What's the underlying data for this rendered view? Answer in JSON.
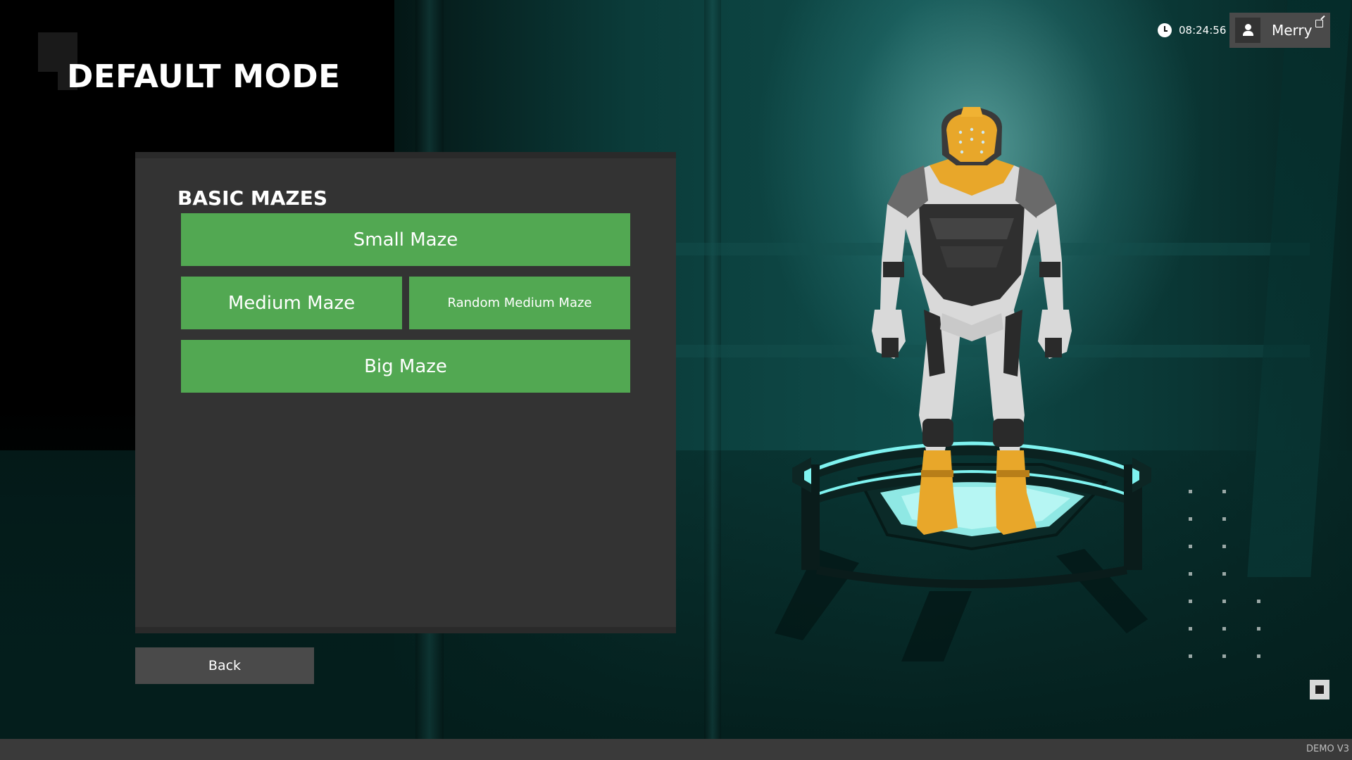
{
  "header": {
    "title": "DEFAULT MODE"
  },
  "hud": {
    "clock_icon": "clock-icon",
    "time": "08:24:56",
    "user_icon": "user-icon",
    "username": "Merry",
    "external_icon": "external-link-icon"
  },
  "panel": {
    "section_title": "BASIC MAZES",
    "buttons": {
      "small": "Small Maze",
      "medium": "Medium Maze",
      "random_medium": "Random Medium Maze",
      "big": "Big Maze"
    }
  },
  "navigation": {
    "back_label": "Back"
  },
  "footer": {
    "version": "DEMO V3"
  },
  "colors": {
    "button_green": "#52a852",
    "panel_bg": "#333333",
    "accent_cyan": "#7ff3f0",
    "armor_yellow": "#e8a72a"
  }
}
